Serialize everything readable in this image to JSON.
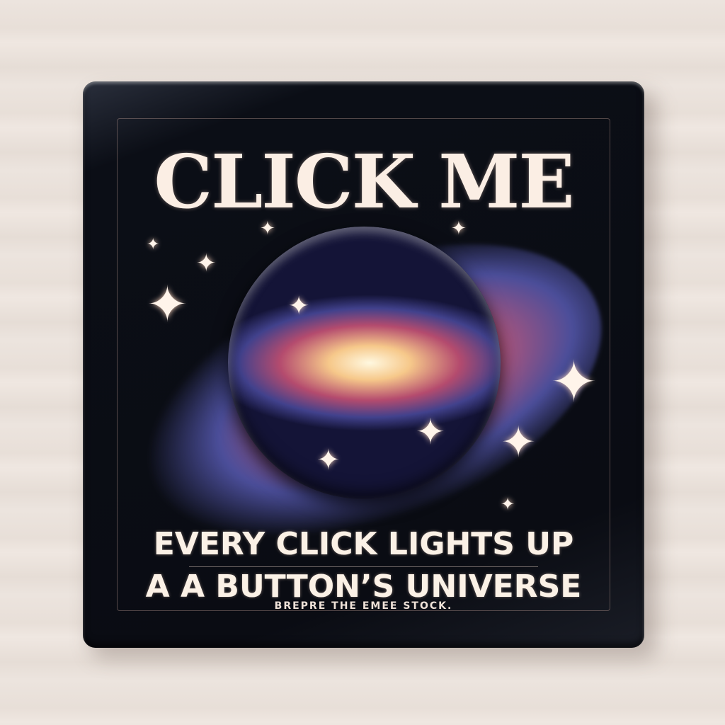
{
  "title": "CLICK ME",
  "tagline_line1": "EVERY CLICK LIGHTS UP",
  "tagline_line2": "A A BUTTON’S UNIVERSE",
  "footer": "BREPRE THE EMEE STOCK."
}
